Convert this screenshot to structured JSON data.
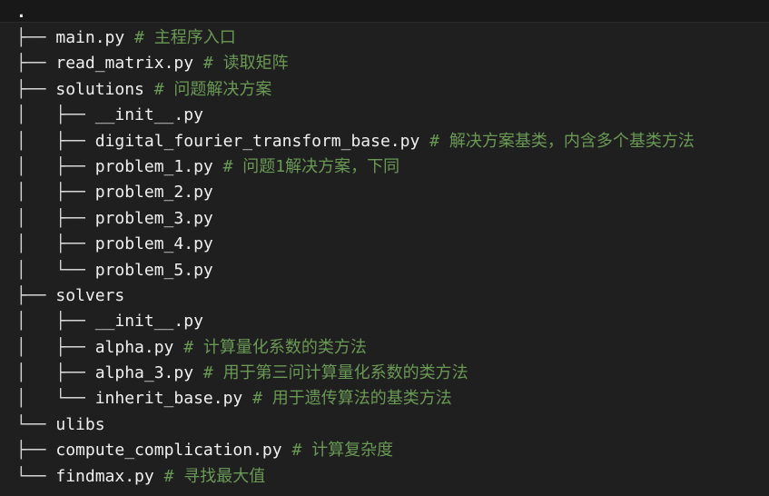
{
  "root": ".",
  "tree": [
    {
      "prefix": "├── ",
      "name": "main.py",
      "comment": " # 主程序入口"
    },
    {
      "prefix": "├── ",
      "name": "read_matrix.py",
      "comment": " # 读取矩阵"
    },
    {
      "prefix": "├── ",
      "name": "solutions",
      "comment": " # 问题解决方案"
    },
    {
      "prefix": "│   ├── ",
      "name": "__init__.py",
      "comment": ""
    },
    {
      "prefix": "│   ├── ",
      "name": "digital_fourier_transform_base.py",
      "comment": " # 解决方案基类，内含多个基类方法"
    },
    {
      "prefix": "│   ├── ",
      "name": "problem_1.py",
      "comment": " # 问题1解决方案，下同"
    },
    {
      "prefix": "│   ├── ",
      "name": "problem_2.py",
      "comment": ""
    },
    {
      "prefix": "│   ├── ",
      "name": "problem_3.py",
      "comment": ""
    },
    {
      "prefix": "│   ├── ",
      "name": "problem_4.py",
      "comment": ""
    },
    {
      "prefix": "│   └── ",
      "name": "problem_5.py",
      "comment": ""
    },
    {
      "prefix": "├── ",
      "name": "solvers",
      "comment": ""
    },
    {
      "prefix": "│   ├── ",
      "name": "__init__.py",
      "comment": ""
    },
    {
      "prefix": "│   ├── ",
      "name": "alpha.py",
      "comment": " # 计算量化系数的类方法"
    },
    {
      "prefix": "│   ├── ",
      "name": "alpha_3.py",
      "comment": " # 用于第三问计算量化系数的类方法"
    },
    {
      "prefix": "│   └── ",
      "name": "inherit_base.py",
      "comment": " # 用于遗传算法的基类方法"
    },
    {
      "prefix": "└── ",
      "name": "ulibs",
      "comment": ""
    },
    {
      "prefix": "├── ",
      "name": "compute_complication.py",
      "comment": " # 计算复杂度"
    },
    {
      "prefix": "└── ",
      "name": "findmax.py",
      "comment": " # 寻找最大值"
    }
  ]
}
